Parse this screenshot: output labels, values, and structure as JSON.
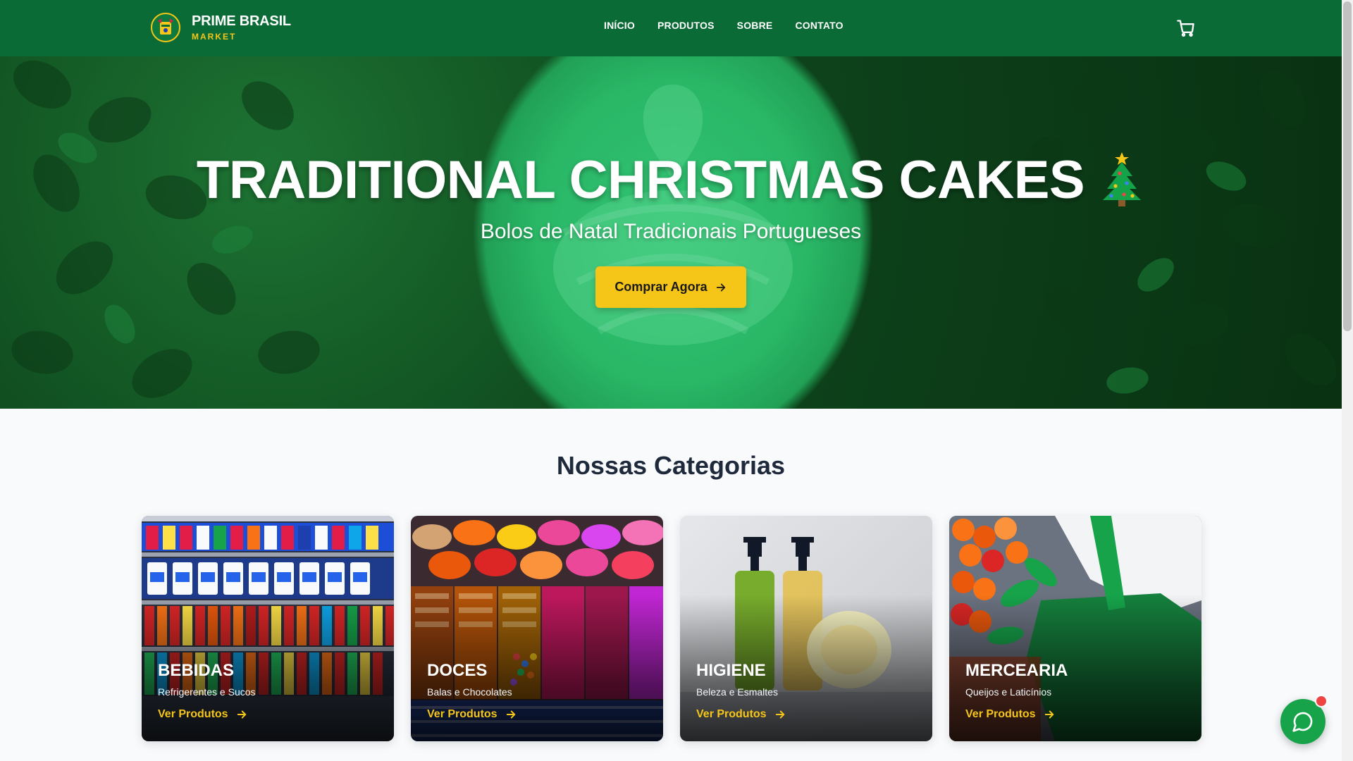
{
  "header": {
    "brand_title": "PRIME BRASIL",
    "brand_subtitle": "MARKET",
    "nav": [
      {
        "label": "INÍCIO"
      },
      {
        "label": "PRODUTOS"
      },
      {
        "label": "SOBRE"
      },
      {
        "label": "CONTATO"
      }
    ],
    "cart_icon": "shopping-cart-icon"
  },
  "hero": {
    "title": "TRADITIONAL CHRISTMAS CAKES",
    "title_emoji": "christmas-tree-icon",
    "subtitle": "Bolos de Natal Tradicionais Portugueses",
    "cta_label": "Comprar Agora",
    "cta_icon": "arrow-right-icon"
  },
  "categories": {
    "title": "Nossas Categorias",
    "items": [
      {
        "title": "BEBIDAS",
        "subtitle": "Refrigerentes e Sucos",
        "link": "Ver Produtos"
      },
      {
        "title": "DOCES",
        "subtitle": "Balas e Chocolates",
        "link": "Ver Produtos"
      },
      {
        "title": "HIGIENE",
        "subtitle": "Beleza e Esmaltes",
        "link": "Ver Produtos"
      },
      {
        "title": "MERCEARIA",
        "subtitle": "Queijos e Laticínios",
        "link": "Ver Produtos"
      }
    ]
  },
  "chat": {
    "icon": "chat-bubble-icon",
    "notification": true
  },
  "colors": {
    "header_bg": "#0b6b36",
    "accent_yellow": "#f5c518",
    "chat_green": "#16a34a",
    "notification_red": "#ef4444",
    "heading": "#1e293b"
  }
}
